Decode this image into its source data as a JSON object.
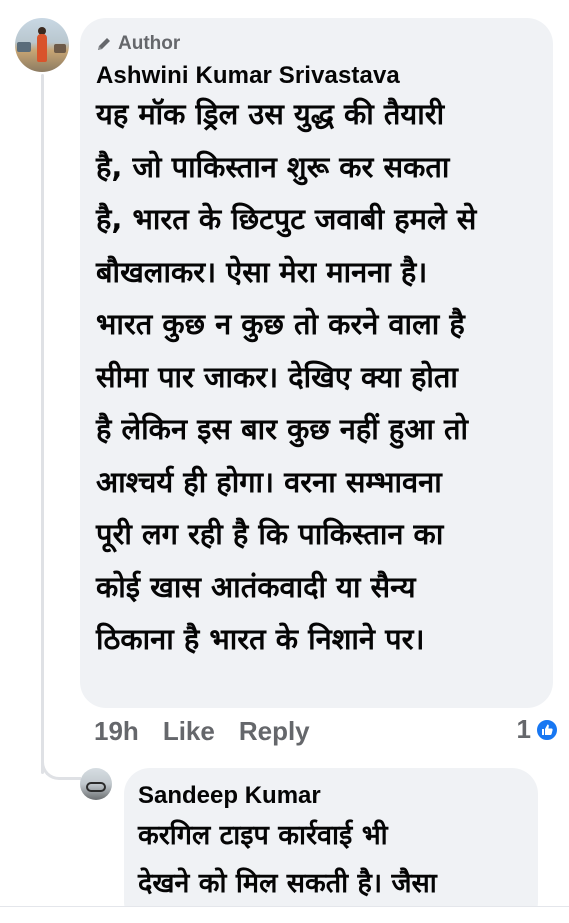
{
  "comment": {
    "badge_label": "Author",
    "author_name": "Ashwini Kumar Srivastava",
    "lines": [
      "यह मॉक ड्रिल उस युद्ध की तैयारी",
      "है, जो पाकिस्तान शुरू कर सकता",
      "है, भारत के छिटपुट जवाबी हमले से",
      "बौखलाकर। ऐसा मेरा मानना है।",
      "भारत कुछ न कुछ तो करने वाला है",
      "सीमा पार जाकर। देखिए क्या होता",
      "है लेकिन इस बार कुछ नहीं हुआ तो",
      "आश्चर्य ही होगा। वरना सम्भावना",
      "पूरी लग रही है कि पाकिस्तान का",
      "कोई खास आतंकवादी या सैन्य",
      "ठिकाना है भारत के निशाने पर।"
    ],
    "time": "19h",
    "like_label": "Like",
    "reply_label": "Reply",
    "reaction_count": "1"
  },
  "reply": {
    "author_name": "Sandeep Kumar",
    "lines": [
      "करगिल टाइप कार्रवाई भी",
      "देखने को मिल सकती है। जैसा"
    ]
  },
  "colors": {
    "bubble": "#f0f2f5",
    "meta_text": "#65676b",
    "like_blue": "#1877f2"
  },
  "icons": {
    "badge": "pencil-icon",
    "reaction": "like-icon"
  }
}
